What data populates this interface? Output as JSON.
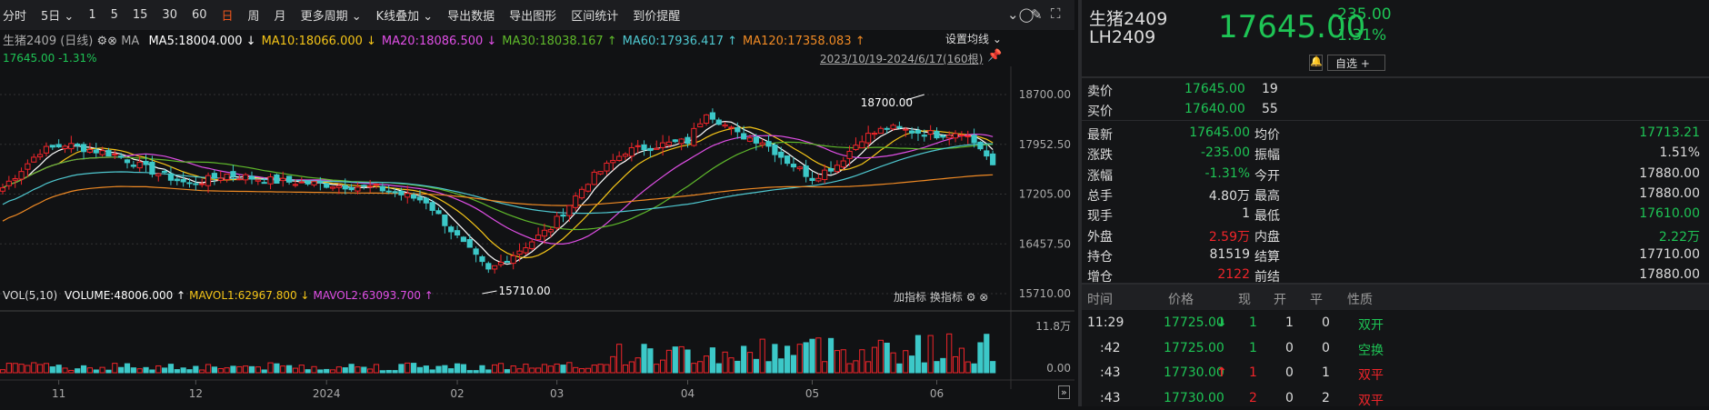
{
  "toolbar": {
    "items": [
      "分时",
      "5日 ⌄",
      "1",
      "5",
      "15",
      "30",
      "60",
      "日",
      "周",
      "月",
      "更多周期 ⌄",
      "K线叠加 ⌄",
      "导出数据",
      "导出图形",
      "区间统计",
      "到价提醒"
    ],
    "active_index": 7
  },
  "legend": {
    "title": "生猪2409 (日线)",
    "ma_label": "MA",
    "ma": [
      {
        "text": "MA5:18004.000 ↓",
        "color": "#ffffff"
      },
      {
        "text": "MA10:18066.000 ↓",
        "color": "#f5c518"
      },
      {
        "text": "MA20:18086.500 ↓",
        "color": "#e04fe6"
      },
      {
        "text": "MA30:18038.167 ↑",
        "color": "#5fb92b"
      },
      {
        "text": "MA60:17936.417 ↑",
        "color": "#4fc8d0"
      },
      {
        "text": "MA120:17358.083 ↑",
        "color": "#f08a24"
      }
    ],
    "last": "17645.00 -1.31%",
    "set_ma": "设置均线 ⌄",
    "range": "2023/10/19-2024/6/17(160根)"
  },
  "vol_legend": {
    "label": "VOL(5,10)",
    "items": [
      {
        "text": "VOLUME:48006.000 ↑",
        "color": "#ffffff"
      },
      {
        "text": "MAVOL1:62967.800 ↓",
        "color": "#f5c518"
      },
      {
        "text": "MAVOL2:63093.700 ↑",
        "color": "#e04fe6"
      }
    ],
    "add": "加指标",
    "switch": "换指标"
  },
  "chart_data": {
    "type": "candlestick",
    "ylim": [
      15710,
      18700
    ],
    "yticks": [
      "18700.00",
      "17952.50",
      "17205.00",
      "16457.50",
      "15710.00"
    ],
    "vol_ticks": [
      "11.8万",
      "0.00"
    ],
    "xticks": [
      {
        "label": "11",
        "i": 9
      },
      {
        "label": "12",
        "i": 31
      },
      {
        "label": "2024",
        "i": 52
      },
      {
        "label": "02",
        "i": 73
      },
      {
        "label": "03",
        "i": 89
      },
      {
        "label": "04",
        "i": 110
      },
      {
        "label": "05",
        "i": 130
      },
      {
        "label": "06",
        "i": 150
      }
    ],
    "annotations": [
      {
        "text": "18700.00",
        "i": 148,
        "value": 18700
      },
      {
        "text": "15710.00",
        "i": 77,
        "value": 15710
      }
    ],
    "close_anchors": [
      [
        0,
        17300
      ],
      [
        6,
        17850
      ],
      [
        10,
        17950
      ],
      [
        18,
        17800
      ],
      [
        24,
        17550
      ],
      [
        30,
        17350
      ],
      [
        36,
        17500
      ],
      [
        44,
        17400
      ],
      [
        52,
        17350
      ],
      [
        60,
        17300
      ],
      [
        68,
        17100
      ],
      [
        74,
        16450
      ],
      [
        78,
        16050
      ],
      [
        82,
        16300
      ],
      [
        88,
        16700
      ],
      [
        94,
        17400
      ],
      [
        100,
        17850
      ],
      [
        106,
        17950
      ],
      [
        110,
        18000
      ],
      [
        113,
        18450
      ],
      [
        118,
        18100
      ],
      [
        122,
        18000
      ],
      [
        126,
        17700
      ],
      [
        130,
        17450
      ],
      [
        134,
        17650
      ],
      [
        138,
        18050
      ],
      [
        142,
        18200
      ],
      [
        146,
        18150
      ],
      [
        150,
        18100
      ],
      [
        154,
        18150
      ],
      [
        157,
        17900
      ],
      [
        159,
        17645
      ]
    ]
  },
  "quote": {
    "name": "生猪2409",
    "code": "LH2409",
    "price": "17645.00",
    "change": "-235.00",
    "pct": "-1.31%",
    "watch": "自选 +",
    "ask_label": "卖价",
    "ask": "17645.00",
    "ask_vol": "19",
    "bid_label": "买价",
    "bid": "17640.00",
    "bid_vol": "55",
    "stats": [
      [
        "最新",
        "17645.00",
        "g",
        "均价",
        "17713.21",
        "g"
      ],
      [
        "涨跌",
        "-235.00",
        "g",
        "振幅",
        "1.51%",
        "w"
      ],
      [
        "涨幅",
        "-1.31%",
        "g",
        "今开",
        "17880.00",
        "w"
      ],
      [
        "总手",
        "4.80万",
        "w",
        "最高",
        "17880.00",
        "w"
      ],
      [
        "现手",
        "1",
        "w",
        "最低",
        "17610.00",
        "g"
      ],
      [
        "外盘",
        "2.59万",
        "r",
        "内盘",
        "2.22万",
        "g"
      ],
      [
        "持仓",
        "81519",
        "w",
        "结算",
        "17710.00",
        "w"
      ],
      [
        "增仓",
        "2122",
        "r",
        "前结",
        "17880.00",
        "w"
      ]
    ]
  },
  "ticks": {
    "headers": [
      "时间",
      "价格",
      "现",
      "开",
      "平",
      "性质"
    ],
    "rows": [
      {
        "time": "11:29",
        "price": "17725.00",
        "arrow": "↓",
        "now": "1",
        "open": "1",
        "close": "0",
        "kind": "双开",
        "c": "g"
      },
      {
        "time": ":42",
        "price": "17725.00",
        "arrow": "",
        "now": "1",
        "open": "0",
        "close": "0",
        "kind": "空换",
        "c": "g"
      },
      {
        "time": ":43",
        "price": "17730.00",
        "arrow": "↑",
        "now": "1",
        "open": "0",
        "close": "1",
        "kind": "双平",
        "c": "r"
      },
      {
        "time": ":43",
        "price": "17730.00",
        "arrow": "",
        "now": "2",
        "open": "0",
        "close": "2",
        "kind": "双平",
        "c": "r"
      }
    ]
  }
}
